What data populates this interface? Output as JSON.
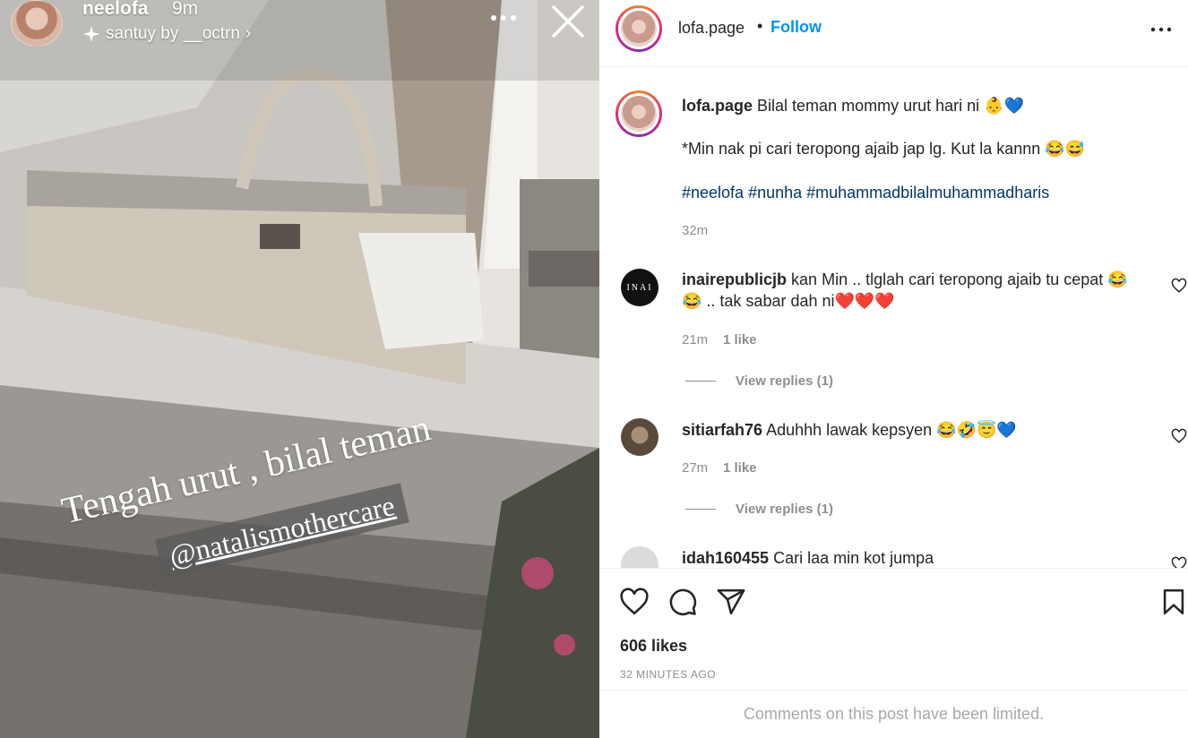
{
  "story": {
    "username": "neelofa",
    "time": "9m",
    "music_label": "santuy by __octrn",
    "music_chevron": "›",
    "caption_line1": "Tengah urut , bilal teman",
    "caption_mention": "@natalismothercare"
  },
  "post": {
    "username": "lofa.page",
    "dot": "•",
    "follow_label": "Follow",
    "caption": {
      "username": "lofa.page",
      "text": "Bilal teman mommy urut hari ni 👶💙",
      "line2": "*Min nak pi cari teropong ajaib jap lg. Kut la kannn 😂😅",
      "hashtags": "#neelofa #nunha #muhammadbilalmuhammadharis",
      "time": "32m"
    },
    "comments": [
      {
        "username": "inairepublicjb",
        "text_line1": "kan Min .. tlglah cari teropong ajaib tu cepat 😂",
        "text_line2": "😂 .. tak sabar dah ni❤️❤️❤️",
        "time": "21m",
        "likes": "1 like",
        "replies": "View replies (1)",
        "avatar_text": "INAI"
      },
      {
        "username": "sitiarfah76",
        "text_line1": "Aduhhh lawak kepsyen 😂🤣😇💙",
        "time": "27m",
        "likes": "1 like",
        "replies": "View replies (1)"
      },
      {
        "username": "idah160455",
        "text_line1": "Cari laa min kot jumpa"
      }
    ],
    "likes_count": "606 likes",
    "time_ago": "32 MINUTES AGO",
    "limited_notice": "Comments on this post have been limited."
  },
  "colors": {
    "link_blue": "#0095f6",
    "hashtag_blue": "#00376b",
    "muted": "#8e8e8e",
    "heart_red": "#ed4956"
  }
}
